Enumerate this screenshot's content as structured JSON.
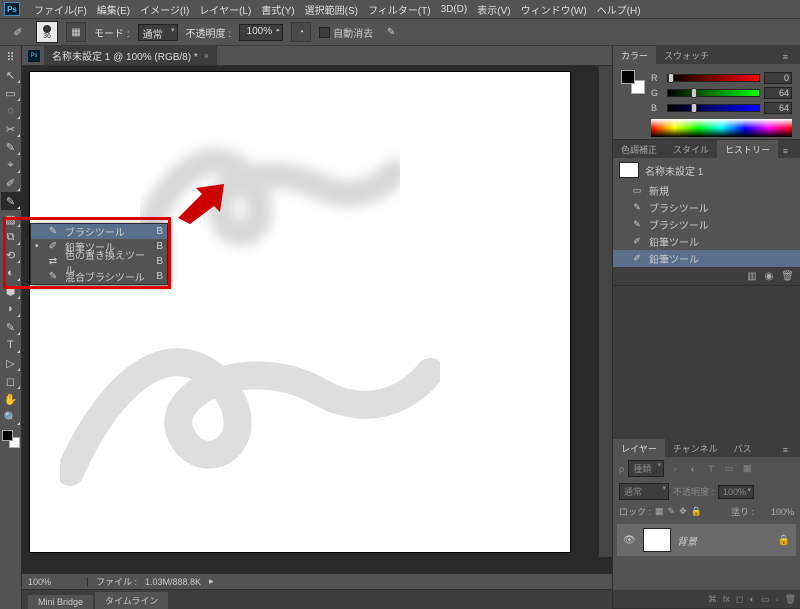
{
  "menu": {
    "items": [
      "ファイル(F)",
      "編集(E)",
      "イメージ(I)",
      "レイヤー(L)",
      "書式(Y)",
      "選択範囲(S)",
      "フィルター(T)",
      "3D(D)",
      "表示(V)",
      "ウィンドウ(W)",
      "ヘルプ(H)"
    ]
  },
  "optbar": {
    "brush_size": "36",
    "mode_label": "モード :",
    "mode_value": "通常",
    "opacity_label": "不透明度 :",
    "opacity_value": "100%",
    "auto_erase": "自動消去"
  },
  "doc": {
    "title": "名称未設定 1 @ 100% (RGB/8) *"
  },
  "flyout": {
    "items": [
      {
        "label": "ブラシツール",
        "key": "B",
        "icon": "✎",
        "sel": true
      },
      {
        "label": "鉛筆ツール",
        "key": "B",
        "icon": "✐",
        "sel": false
      },
      {
        "label": "色の置き換えツール",
        "key": "B",
        "icon": "⇄",
        "sel": false
      },
      {
        "label": "混合ブラシツール",
        "key": "B",
        "icon": "✎",
        "sel": false
      }
    ]
  },
  "status": {
    "zoom": "100%",
    "info_label": "ファイル :",
    "info_value": "1.03M/888.8K"
  },
  "bottom_tabs": {
    "items": [
      "Mini Bridge",
      "タイムライン"
    ]
  },
  "color": {
    "tab1": "カラー",
    "tab2": "スウォッチ",
    "r": "R",
    "r_val": "0",
    "g": "G",
    "g_val": "64",
    "b": "B",
    "b_val": "64"
  },
  "history": {
    "tabs": [
      "色調補正",
      "スタイル",
      "ヒストリー"
    ],
    "doc": "名称未設定 1",
    "items": [
      {
        "label": "新規",
        "icon": "▭"
      },
      {
        "label": "ブラシツール",
        "icon": "✎"
      },
      {
        "label": "ブラシツール",
        "icon": "✎"
      },
      {
        "label": "鉛筆ツール",
        "icon": "✐"
      },
      {
        "label": "鉛筆ツール",
        "icon": "✐",
        "sel": true
      }
    ]
  },
  "layers": {
    "tabs": [
      "レイヤー",
      "チャンネル",
      "パス"
    ],
    "kind_label": "種類",
    "blend": "通常",
    "opacity_label": "不透明度 :",
    "opacity": "100%",
    "lock": "ロック :",
    "fill_label": "塗り :",
    "fill": "100%",
    "layer_name": "背景"
  },
  "tools": [
    "↖",
    "▭",
    "◌",
    "✂",
    "✎",
    "⌖",
    "✐",
    "▨",
    "⧉",
    "⟲",
    "◐",
    "✎",
    "⬚",
    "T",
    "▷",
    "◻",
    "✋",
    "🔍"
  ]
}
